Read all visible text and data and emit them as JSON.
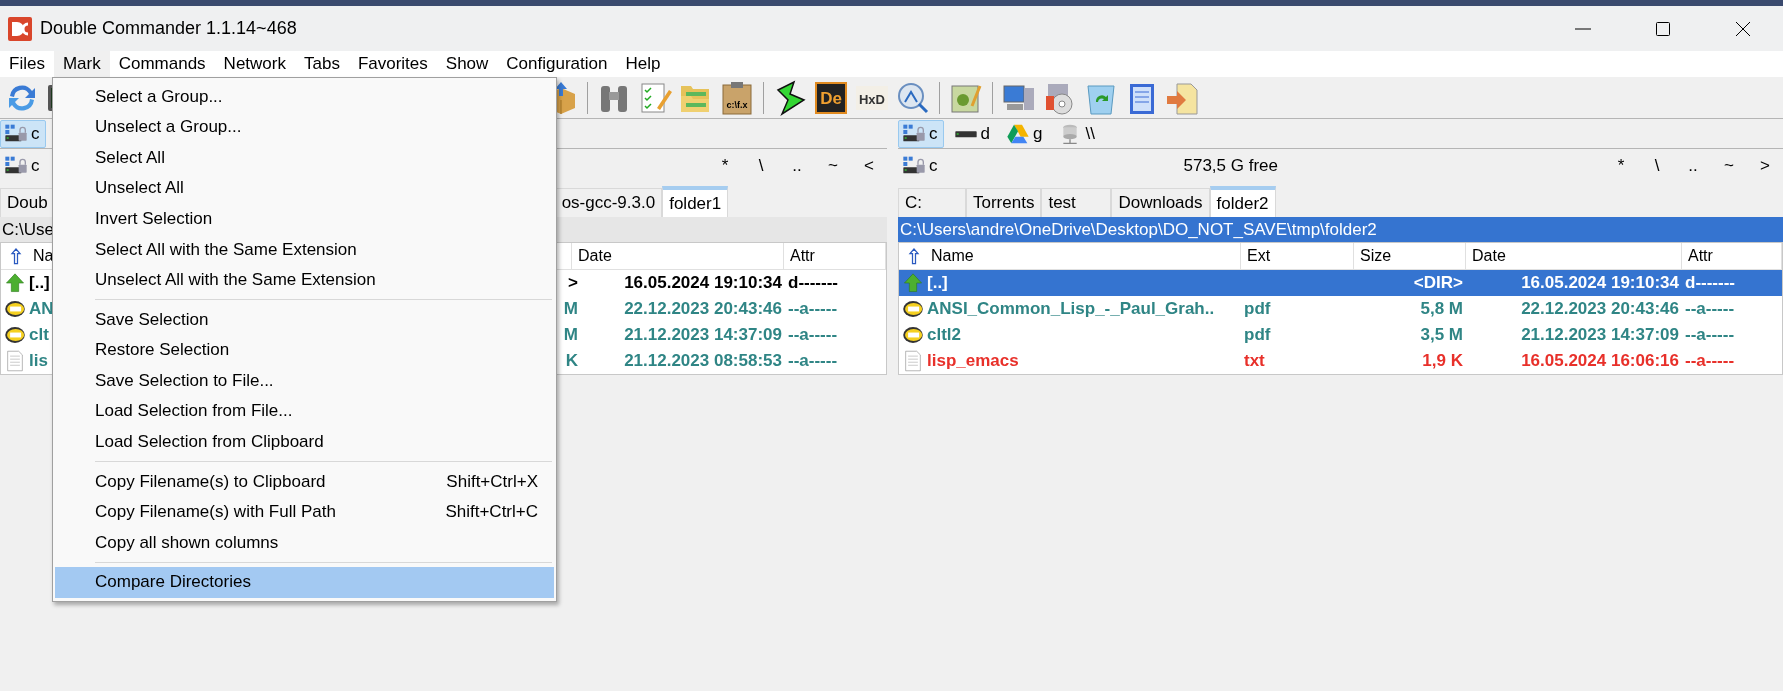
{
  "window": {
    "title": "Double Commander 1.1.14~468"
  },
  "menu_bar": [
    {
      "label": "Files",
      "selected": false
    },
    {
      "label": "Mark",
      "selected": true
    },
    {
      "label": "Commands",
      "selected": false
    },
    {
      "label": "Network",
      "selected": false
    },
    {
      "label": "Tabs",
      "selected": false
    },
    {
      "label": "Favorites",
      "selected": false
    },
    {
      "label": "Show",
      "selected": false
    },
    {
      "label": "Configuration",
      "selected": false
    },
    {
      "label": "Help",
      "selected": false
    }
  ],
  "toolbar": {
    "left": [
      {
        "kind": "refresh"
      },
      {
        "kind": "terminal"
      }
    ],
    "right": [
      {
        "kind": "box"
      },
      {
        "kind": "separator"
      },
      {
        "kind": "binoculars"
      },
      {
        "kind": "checklist"
      },
      {
        "kind": "folders"
      },
      {
        "kind": "clipboard",
        "text": "c:\\f.x"
      },
      {
        "kind": "separator"
      },
      {
        "kind": "bolt"
      },
      {
        "kind": "logo",
        "text": "De"
      },
      {
        "kind": "hex",
        "text": "HxD"
      },
      {
        "kind": "magnifier"
      },
      {
        "kind": "separator"
      },
      {
        "kind": "edit"
      },
      {
        "kind": "separator"
      },
      {
        "kind": "computer"
      },
      {
        "kind": "disc"
      },
      {
        "kind": "recycle"
      },
      {
        "kind": "notepad"
      },
      {
        "kind": "move"
      }
    ]
  },
  "left_panel": {
    "drives": [
      {
        "letter": "c",
        "kind": "hdd-lock",
        "selected": true
      }
    ],
    "header": {
      "drive": "c",
      "nav": [
        "*",
        "\\",
        "..",
        "~",
        "<"
      ]
    },
    "tabs": [
      {
        "label": "Doub",
        "selected": false
      },
      {
        "label": "os-gcc-9.3.0",
        "selected": false
      },
      {
        "label": "folder1",
        "selected": true
      }
    ],
    "path": {
      "text": "C:\\Use",
      "active": false
    },
    "columns": [
      "Na",
      "Date",
      "Attr"
    ],
    "rows": [
      {
        "kind": "up",
        "name": "[..]",
        "size": ">",
        "date": "16.05.2024 19:10:34",
        "attr": "d-------",
        "selected": false,
        "color": "#000000"
      },
      {
        "kind": "pdf",
        "name": "AN",
        "size": "M",
        "date": "22.12.2023 20:43:46",
        "attr": "--a-----",
        "selected": false,
        "color": "#2f8585"
      },
      {
        "kind": "pdf",
        "name": "clt",
        "size": "M",
        "date": "21.12.2023 14:37:09",
        "attr": "--a-----",
        "selected": false,
        "color": "#2f8585"
      },
      {
        "kind": "text",
        "name": "lis",
        "size": "K",
        "date": "21.12.2023 08:58:53",
        "attr": "--a-----",
        "selected": false,
        "color": "#2f8585"
      }
    ]
  },
  "right_panel": {
    "drives": [
      {
        "letter": "c",
        "kind": "hdd-lock",
        "selected": true
      },
      {
        "letter": "d",
        "kind": "hdd",
        "selected": false
      },
      {
        "letter": "g",
        "kind": "cloud",
        "selected": false
      },
      {
        "letter": "\\\\",
        "kind": "network",
        "selected": false
      }
    ],
    "header": {
      "drive": "c",
      "free": "573,5 G free",
      "nav": [
        "*",
        "\\",
        "..",
        "~",
        ">"
      ]
    },
    "tabs": [
      {
        "label": "C:",
        "selected": false
      },
      {
        "label": "Torrents",
        "selected": false
      },
      {
        "label": "test",
        "selected": false
      },
      {
        "label": "Downloads",
        "selected": false
      },
      {
        "label": "folder2",
        "selected": true
      }
    ],
    "path": {
      "text": "C:\\Users\\andre\\OneDrive\\Desktop\\DO_NOT_SAVE\\tmp\\folder2",
      "active": true
    },
    "columns": [
      "Name",
      "Ext",
      "Size",
      "Date",
      "Attr"
    ],
    "rows": [
      {
        "kind": "up",
        "name": "[..]",
        "size": "<DIR>",
        "date": "16.05.2024 19:10:34",
        "attr": "d-------",
        "selected": true
      },
      {
        "kind": "pdf",
        "name": "ANSI_Common_Lisp_-_Paul_Grah..",
        "ext": "pdf",
        "size": "5,8 M",
        "date": "22.12.2023 20:43:46",
        "attr": "--a-----",
        "selected": false,
        "color": "#2f8585"
      },
      {
        "kind": "pdf",
        "name": "cltl2",
        "ext": "pdf",
        "size": "3,5 M",
        "date": "21.12.2023 14:37:09",
        "attr": "--a-----",
        "selected": false,
        "color": "#2f8585"
      },
      {
        "kind": "text",
        "name": "lisp_emacs",
        "ext": "txt",
        "size": "1,9 K",
        "date": "16.05.2024 16:06:16",
        "attr": "--a-----",
        "selected": false,
        "color": "#e8302a"
      }
    ]
  },
  "mark_menu": {
    "items": [
      {
        "kind": "item",
        "label": "Select a Group...",
        "selected": false
      },
      {
        "kind": "item",
        "label": "Unselect a Group...",
        "selected": false
      },
      {
        "kind": "item",
        "label": "Select All",
        "selected": false
      },
      {
        "kind": "item",
        "label": "Unselect All",
        "selected": false
      },
      {
        "kind": "item",
        "label": "Invert Selection",
        "selected": false
      },
      {
        "kind": "item",
        "label": "Select All with the Same Extension",
        "selected": false
      },
      {
        "kind": "item",
        "label": "Unselect All with the Same Extension",
        "selected": false
      },
      {
        "kind": "separator"
      },
      {
        "kind": "item",
        "label": "Save Selection",
        "selected": false
      },
      {
        "kind": "item",
        "label": "Restore Selection",
        "selected": false
      },
      {
        "kind": "item",
        "label": "Save Selection to File...",
        "selected": false
      },
      {
        "kind": "item",
        "label": "Load Selection from File...",
        "selected": false
      },
      {
        "kind": "item",
        "label": "Load Selection from Clipboard",
        "selected": false
      },
      {
        "kind": "separator"
      },
      {
        "kind": "item",
        "label": "Copy Filename(s) to Clipboard",
        "shortcut": "Shift+Ctrl+X",
        "selected": false
      },
      {
        "kind": "item",
        "label": "Copy Filename(s) with Full Path",
        "shortcut": "Shift+Ctrl+C",
        "selected": false
      },
      {
        "kind": "item",
        "label": "Copy all shown columns",
        "selected": false
      },
      {
        "kind": "separator"
      },
      {
        "kind": "item",
        "label": "Compare Directories",
        "selected": true
      }
    ]
  }
}
